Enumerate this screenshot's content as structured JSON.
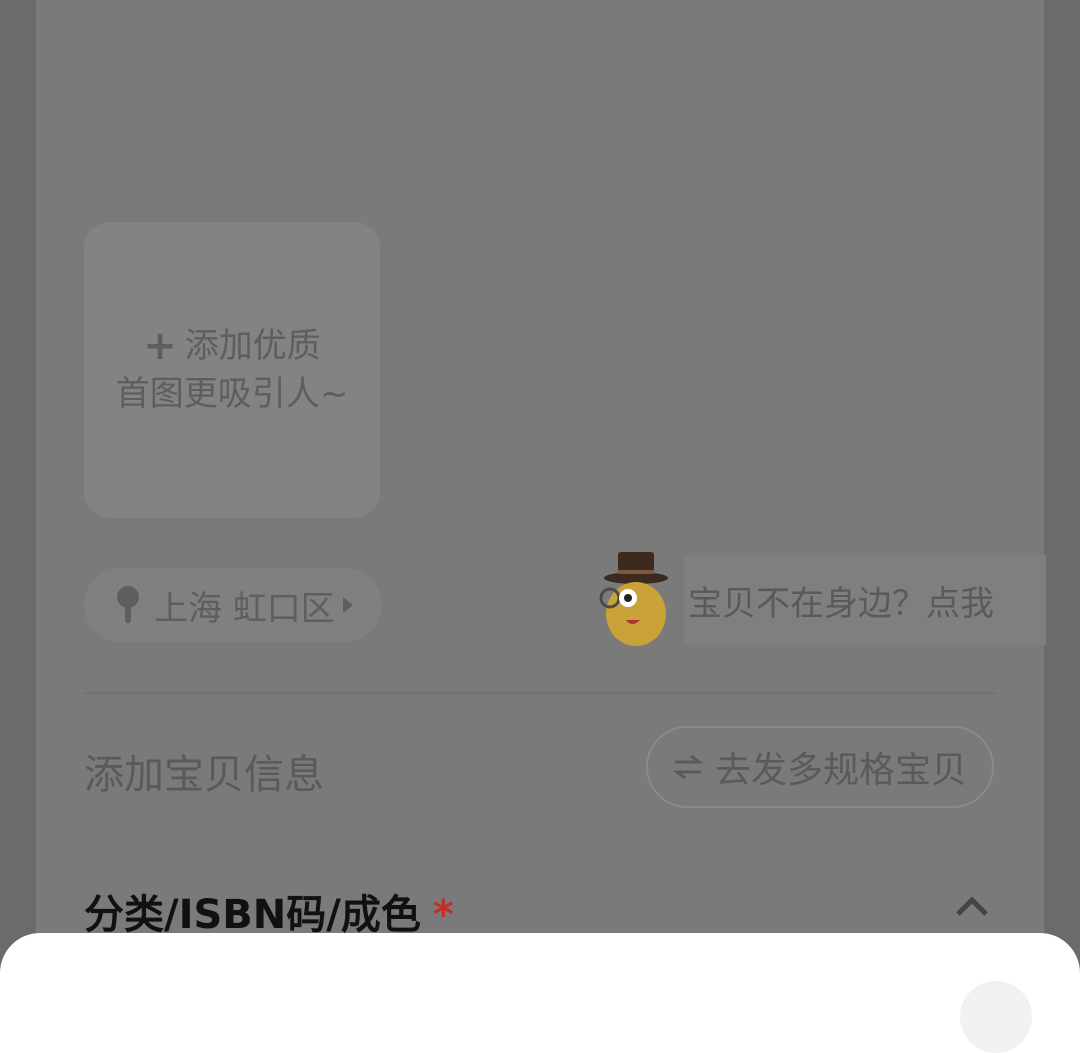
{
  "photo_upload": {
    "line1": "添加优质",
    "line2": "首图更吸引人~"
  },
  "location": {
    "label": "上海 虹口区"
  },
  "helper": {
    "label": "宝贝不在身边？点我"
  },
  "item_info": {
    "title": "添加宝贝信息",
    "multi_spec_button": "去发多规格宝贝"
  },
  "category": {
    "title": "分类/ISBN码/成色",
    "required_mark": "*"
  },
  "colors": {
    "required": "#c0302a"
  }
}
